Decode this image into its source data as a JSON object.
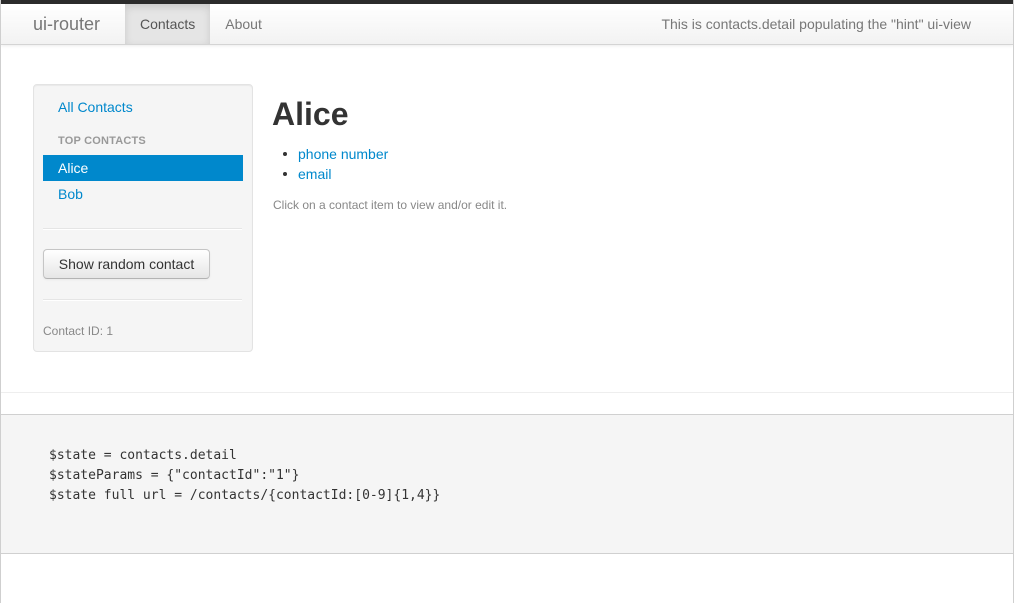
{
  "navbar": {
    "brand": "ui-router",
    "tabs": [
      {
        "label": "Contacts",
        "active": true
      },
      {
        "label": "About",
        "active": false
      }
    ],
    "hint": "This is contacts.detail populating the \"hint\" ui-view"
  },
  "sidebar": {
    "all_contacts": "All Contacts",
    "top_contacts_header": "TOP CONTACTS",
    "contacts": [
      {
        "name": "Alice",
        "active": true
      },
      {
        "name": "Bob",
        "active": false
      }
    ],
    "random_button": "Show random contact",
    "contact_id_label": "Contact ID: 1"
  },
  "main": {
    "title": "Alice",
    "items": [
      "phone number",
      "email"
    ],
    "help": "Click on a contact item to view and/or edit it."
  },
  "state": {
    "line1": "$state = contacts.detail",
    "line2": "$stateParams = {\"contactId\":\"1\"}",
    "line3": "$state full url = /contacts/{contactId:[0-9]{1,4}}"
  },
  "colors": {
    "link": "#0088cc",
    "active_bg": "#0088cc",
    "panel_bg": "#f5f5f5"
  }
}
